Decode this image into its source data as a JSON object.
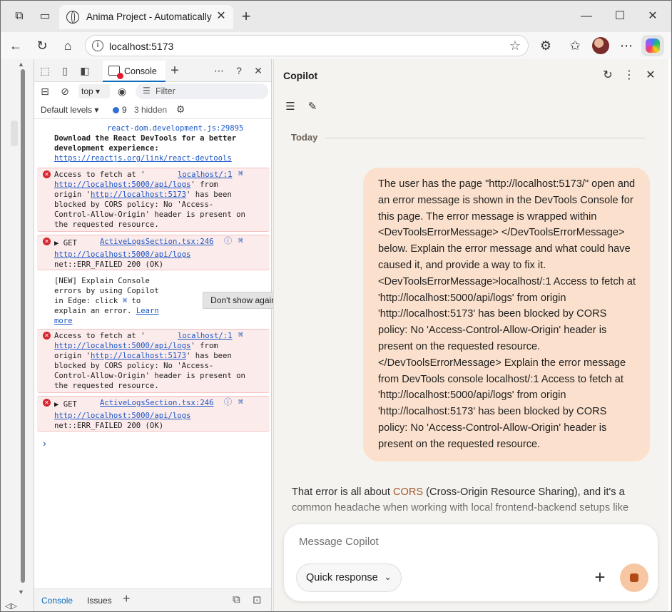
{
  "browser": {
    "tab_title": "Anima Project - Automatically ge",
    "url": "localhost:5173"
  },
  "devtools": {
    "console_tab": "Console",
    "context": "top",
    "filter_placeholder": "Filter",
    "levels": "Default levels",
    "issues_count": "9",
    "hidden": "3 hidden",
    "logs": {
      "l1_src": "react-dom.development.js:29895",
      "l1_line1": "Download the React DevTools for a better",
      "l1_line2": "development experience:",
      "l1_link": "https://reactjs.org/link/react-devtools",
      "e1_src": "localhost/:1",
      "e1_a": "Access to fetch at '",
      "e1_link1": "http://localhost:5000/api/logs",
      "e1_b": "' from",
      "e1_c": "origin '",
      "e1_link2": "http://localhost:5173",
      "e1_d": "' has been",
      "e1_e": "blocked by CORS policy: No 'Access-",
      "e1_f": "Control-Allow-Origin' header is present on",
      "e1_g": "the requested resource.",
      "g1_method": "GET",
      "g1_src": "ActiveLogsSection.tsx:246",
      "g1_link": "http://localhost:5000/api/logs",
      "g1_status": "net::ERR_FAILED 200 (OK)",
      "tip1": "[NEW] Explain Console",
      "tip2": "errors by using Copilot",
      "tip3a": "in Edge: click",
      "tip3b": "to",
      "tip4a": "explain an error.",
      "tip4_link": "Learn",
      "tip5_link": "more",
      "dont_show": "Don't show again",
      "e2_src": "localhost/:1",
      "e2_a": "Access to fetch at '",
      "e2_link1": "http://localhost:5000/api/logs",
      "e2_b": "' from",
      "e2_c": "origin '",
      "e2_link2": "http://localhost:5173",
      "e2_d": "' has been",
      "e2_e": "blocked by CORS policy: No 'Access-",
      "e2_f": "Control-Allow-Origin' header is present on",
      "e2_g": "the requested resource.",
      "g2_method": "GET",
      "g2_src": "ActiveLogsSection.tsx:246",
      "g2_link": "http://localhost:5000/api/logs",
      "g2_status": "net::ERR_FAILED 200 (OK)"
    },
    "bottom_tabs": {
      "console": "Console",
      "issues": "Issues"
    }
  },
  "copilot": {
    "title": "Copilot",
    "today": "Today",
    "user_message": "The user has the page \"http://localhost:5173/\" open and an error message is shown in the DevTools Console for this page. The error message is wrapped within <DevToolsErrorMessage> </DevToolsErrorMessage> below. Explain the error message and what could have caused it, and provide a way to fix it. <DevToolsErrorMessage>localhost/:1 Access to fetch at 'http://localhost:5000/api/logs' from origin 'http://localhost:5173' has been blocked by CORS policy: No 'Access-Control-Allow-Origin' header is present on the requested resource. </DevToolsErrorMessage> Explain the error message from DevTools console localhost/:1  Access to fetch at 'http://localhost:5000/api/logs' from origin 'http://localhost:5173' has been blocked by CORS policy: No 'Access-Control-Allow-Origin' header is present on the requested resource.",
    "reply_pre": "That error is all about ",
    "reply_cors": "CORS",
    "reply_post": " (Cross-Origin Resource Sharing), and it's a common headache when working with local frontend-backend setups like",
    "composer_placeholder": "Message Copilot",
    "mode": "Quick response"
  }
}
